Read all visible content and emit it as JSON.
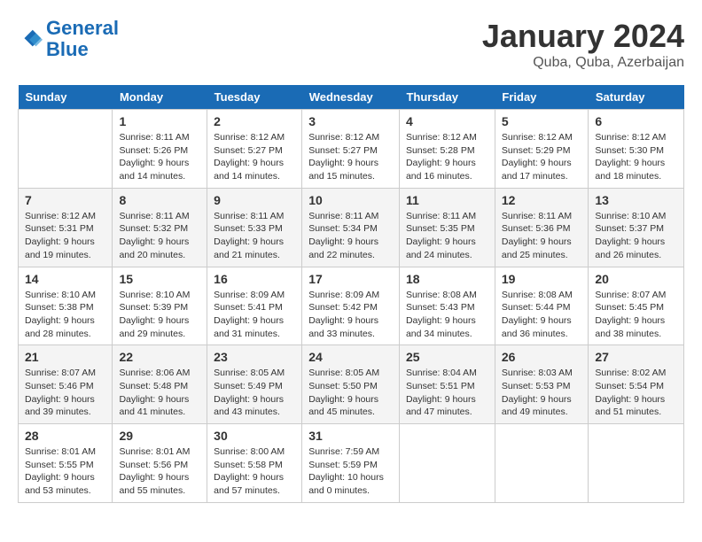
{
  "header": {
    "logo_line1": "General",
    "logo_line2": "Blue",
    "month_year": "January 2024",
    "location": "Quba, Quba, Azerbaijan"
  },
  "weekdays": [
    "Sunday",
    "Monday",
    "Tuesday",
    "Wednesday",
    "Thursday",
    "Friday",
    "Saturday"
  ],
  "weeks": [
    [
      {
        "day": "",
        "info": ""
      },
      {
        "day": "1",
        "info": "Sunrise: 8:11 AM\nSunset: 5:26 PM\nDaylight: 9 hours\nand 14 minutes."
      },
      {
        "day": "2",
        "info": "Sunrise: 8:12 AM\nSunset: 5:27 PM\nDaylight: 9 hours\nand 14 minutes."
      },
      {
        "day": "3",
        "info": "Sunrise: 8:12 AM\nSunset: 5:27 PM\nDaylight: 9 hours\nand 15 minutes."
      },
      {
        "day": "4",
        "info": "Sunrise: 8:12 AM\nSunset: 5:28 PM\nDaylight: 9 hours\nand 16 minutes."
      },
      {
        "day": "5",
        "info": "Sunrise: 8:12 AM\nSunset: 5:29 PM\nDaylight: 9 hours\nand 17 minutes."
      },
      {
        "day": "6",
        "info": "Sunrise: 8:12 AM\nSunset: 5:30 PM\nDaylight: 9 hours\nand 18 minutes."
      }
    ],
    [
      {
        "day": "7",
        "info": "Sunrise: 8:12 AM\nSunset: 5:31 PM\nDaylight: 9 hours\nand 19 minutes."
      },
      {
        "day": "8",
        "info": "Sunrise: 8:11 AM\nSunset: 5:32 PM\nDaylight: 9 hours\nand 20 minutes."
      },
      {
        "day": "9",
        "info": "Sunrise: 8:11 AM\nSunset: 5:33 PM\nDaylight: 9 hours\nand 21 minutes."
      },
      {
        "day": "10",
        "info": "Sunrise: 8:11 AM\nSunset: 5:34 PM\nDaylight: 9 hours\nand 22 minutes."
      },
      {
        "day": "11",
        "info": "Sunrise: 8:11 AM\nSunset: 5:35 PM\nDaylight: 9 hours\nand 24 minutes."
      },
      {
        "day": "12",
        "info": "Sunrise: 8:11 AM\nSunset: 5:36 PM\nDaylight: 9 hours\nand 25 minutes."
      },
      {
        "day": "13",
        "info": "Sunrise: 8:10 AM\nSunset: 5:37 PM\nDaylight: 9 hours\nand 26 minutes."
      }
    ],
    [
      {
        "day": "14",
        "info": "Sunrise: 8:10 AM\nSunset: 5:38 PM\nDaylight: 9 hours\nand 28 minutes."
      },
      {
        "day": "15",
        "info": "Sunrise: 8:10 AM\nSunset: 5:39 PM\nDaylight: 9 hours\nand 29 minutes."
      },
      {
        "day": "16",
        "info": "Sunrise: 8:09 AM\nSunset: 5:41 PM\nDaylight: 9 hours\nand 31 minutes."
      },
      {
        "day": "17",
        "info": "Sunrise: 8:09 AM\nSunset: 5:42 PM\nDaylight: 9 hours\nand 33 minutes."
      },
      {
        "day": "18",
        "info": "Sunrise: 8:08 AM\nSunset: 5:43 PM\nDaylight: 9 hours\nand 34 minutes."
      },
      {
        "day": "19",
        "info": "Sunrise: 8:08 AM\nSunset: 5:44 PM\nDaylight: 9 hours\nand 36 minutes."
      },
      {
        "day": "20",
        "info": "Sunrise: 8:07 AM\nSunset: 5:45 PM\nDaylight: 9 hours\nand 38 minutes."
      }
    ],
    [
      {
        "day": "21",
        "info": "Sunrise: 8:07 AM\nSunset: 5:46 PM\nDaylight: 9 hours\nand 39 minutes."
      },
      {
        "day": "22",
        "info": "Sunrise: 8:06 AM\nSunset: 5:48 PM\nDaylight: 9 hours\nand 41 minutes."
      },
      {
        "day": "23",
        "info": "Sunrise: 8:05 AM\nSunset: 5:49 PM\nDaylight: 9 hours\nand 43 minutes."
      },
      {
        "day": "24",
        "info": "Sunrise: 8:05 AM\nSunset: 5:50 PM\nDaylight: 9 hours\nand 45 minutes."
      },
      {
        "day": "25",
        "info": "Sunrise: 8:04 AM\nSunset: 5:51 PM\nDaylight: 9 hours\nand 47 minutes."
      },
      {
        "day": "26",
        "info": "Sunrise: 8:03 AM\nSunset: 5:53 PM\nDaylight: 9 hours\nand 49 minutes."
      },
      {
        "day": "27",
        "info": "Sunrise: 8:02 AM\nSunset: 5:54 PM\nDaylight: 9 hours\nand 51 minutes."
      }
    ],
    [
      {
        "day": "28",
        "info": "Sunrise: 8:01 AM\nSunset: 5:55 PM\nDaylight: 9 hours\nand 53 minutes."
      },
      {
        "day": "29",
        "info": "Sunrise: 8:01 AM\nSunset: 5:56 PM\nDaylight: 9 hours\nand 55 minutes."
      },
      {
        "day": "30",
        "info": "Sunrise: 8:00 AM\nSunset: 5:58 PM\nDaylight: 9 hours\nand 57 minutes."
      },
      {
        "day": "31",
        "info": "Sunrise: 7:59 AM\nSunset: 5:59 PM\nDaylight: 10 hours\nand 0 minutes."
      },
      {
        "day": "",
        "info": ""
      },
      {
        "day": "",
        "info": ""
      },
      {
        "day": "",
        "info": ""
      }
    ]
  ]
}
